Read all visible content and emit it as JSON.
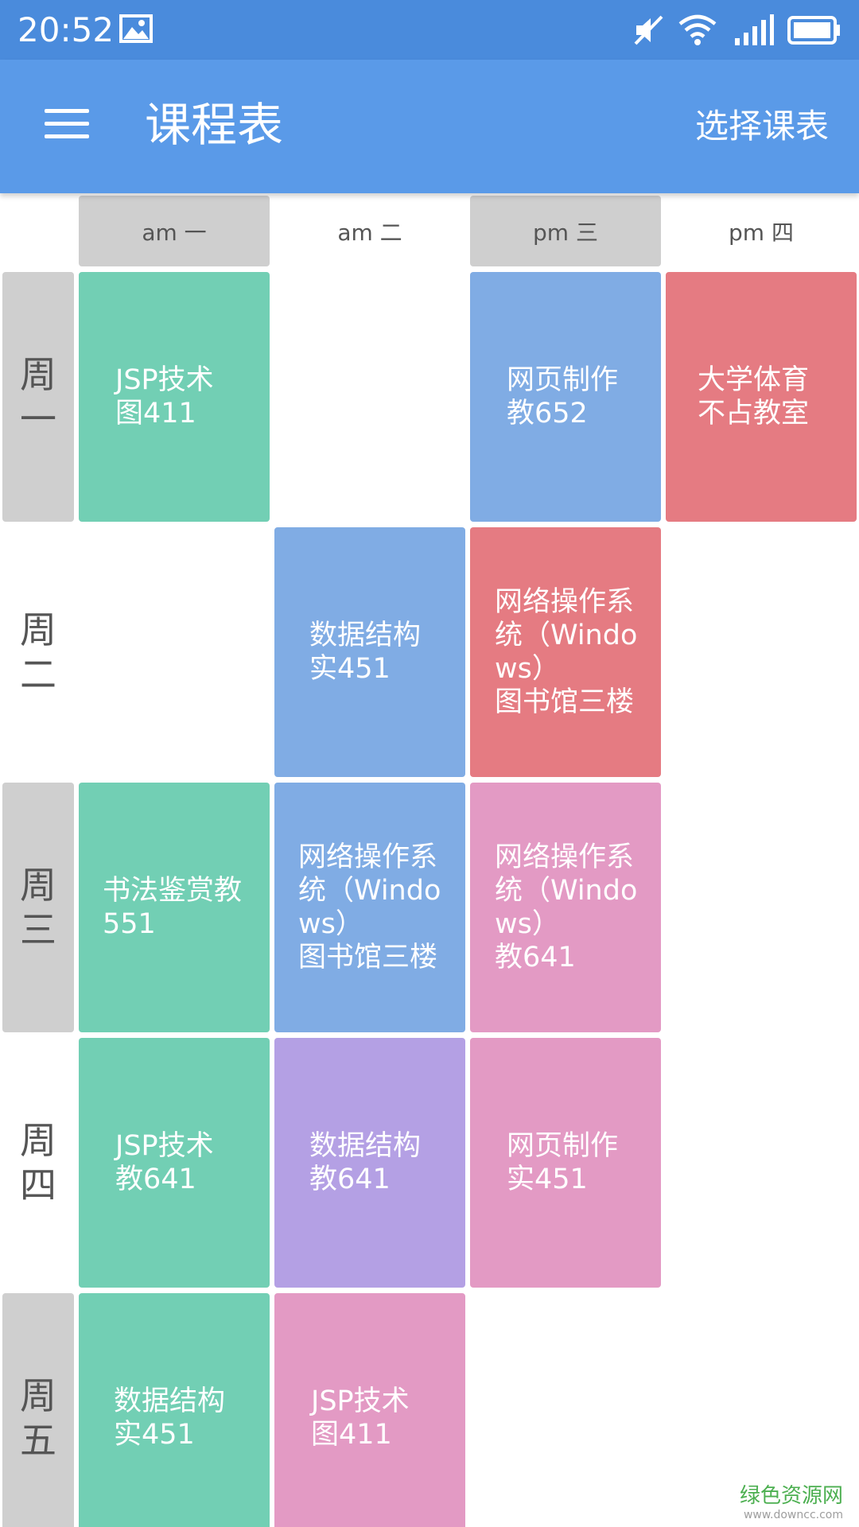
{
  "status_bar": {
    "time": "20:52",
    "icons": [
      "image-icon",
      "mute-icon",
      "wifi-icon",
      "signal-icon",
      "battery-icon"
    ]
  },
  "app_bar": {
    "menu_icon": "menu-icon",
    "title": "课程表",
    "action": "选择课表"
  },
  "periods": [
    "am 一",
    "am 二",
    "pm 三",
    "pm 四"
  ],
  "days": [
    "周一",
    "周二",
    "周三",
    "周四",
    "周五"
  ],
  "courses": {
    "mon_1": "JSP技术\n图411",
    "mon_3": "网页制作\n教652",
    "mon_4": "大学体育\n不占教室",
    "tue_2": "数据结构\n实451",
    "tue_3": "网络操作系统（Windows）\n图书馆三楼",
    "wed_1": "书法鉴赏教551",
    "wed_2": "网络操作系统（Windows）\n图书馆三楼",
    "wed_3": "网络操作系统（Windows）\n教641",
    "thu_1": "JSP技术\n教641",
    "thu_2": "数据结构\n教641",
    "thu_3": "网页制作\n实451",
    "fri_1": "数据结构\n实451",
    "fri_2": "JSP技术\n图411"
  },
  "colors": {
    "status_bar": "#4a8bdc",
    "app_bar": "#5a9ae8",
    "green": "#72cfb4",
    "blue": "#80ace4",
    "red": "#e57b82",
    "pink": "#e39ac4",
    "purple": "#b4a0e4",
    "gray": "#cfcfcf"
  },
  "watermark": {
    "name": "绿色资源网",
    "url": "www.downcc.com"
  }
}
